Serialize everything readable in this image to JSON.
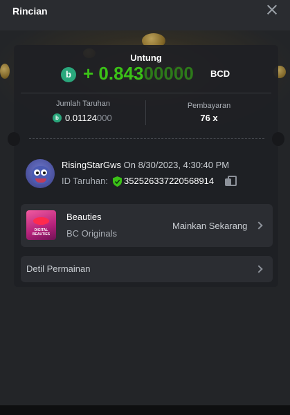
{
  "header": {
    "title": "Rincian"
  },
  "profit": {
    "label": "Untung",
    "value_bright": "+ 0.843",
    "value_dim": "00000",
    "unit": "BCD",
    "coin_symbol": "b"
  },
  "bet": {
    "label": "Jumlah Taruhan",
    "amount_bright": "0.01124",
    "amount_dim": "000",
    "coin_symbol": "b"
  },
  "payout": {
    "label": "Pembayaran",
    "value": "76 x"
  },
  "user": {
    "name": "RisingStarGws",
    "date_prefix": "On",
    "datetime": "8/30/2023, 4:30:40 PM",
    "id_label": "ID Taruhan:",
    "bet_id": "352526337220568914"
  },
  "game": {
    "name": "Beauties",
    "provider": "BC Originals",
    "thumb_text": "DIGITAL BEAUTIES",
    "play_label": "Mainkan Sekarang"
  },
  "details": {
    "label": "Detil Permainan"
  },
  "colors": {
    "profit_green": "#3bc117",
    "coin_teal": "#2aa77c",
    "verified_green": "#3bc117",
    "background": "#232528"
  },
  "icons": [
    "close-icon",
    "bcd-coin-icon",
    "shield-check-icon",
    "copy-icon",
    "chevron-right-icon"
  ]
}
